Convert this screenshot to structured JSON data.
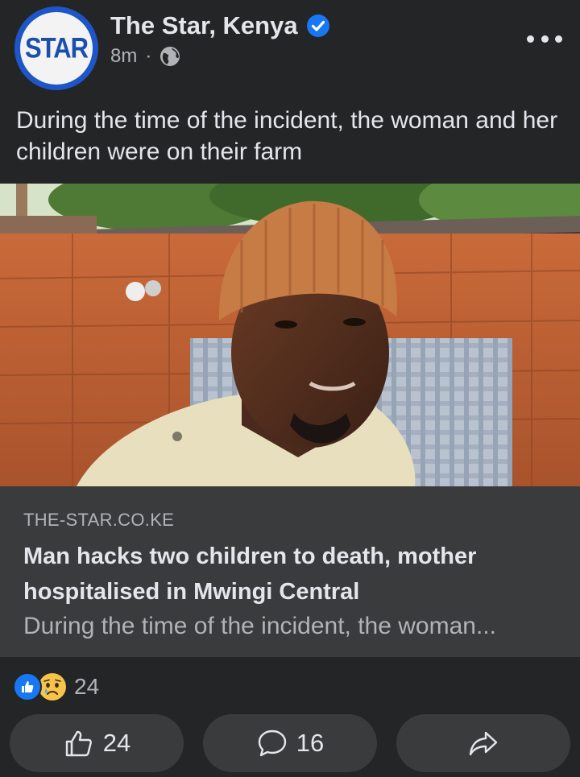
{
  "post": {
    "page_name": "The Star, Kenya",
    "verified": true,
    "time": "8m",
    "separator": "·",
    "privacy_icon": "globe-icon",
    "caption": "During the time of the incident, the woman and her children were on their farm"
  },
  "avatar": {
    "logo_text": "STAR"
  },
  "link_preview": {
    "domain": "THE-STAR.CO.KE",
    "title": "Man hacks two children to death, mother hospitalised in Mwingi Central",
    "description": "During the time of the incident, the woman..."
  },
  "reactions": {
    "icons": [
      "like-reaction-icon",
      "sad-reaction-icon"
    ],
    "count": "24"
  },
  "actions": {
    "like_count": "24",
    "comment_count": "16",
    "share_icon": "share-icon"
  },
  "colors": {
    "background": "#242526",
    "card": "#3a3b3c",
    "accent": "#1877f2",
    "text_primary": "#e4e6eb",
    "text_secondary": "#b0b3b8"
  }
}
